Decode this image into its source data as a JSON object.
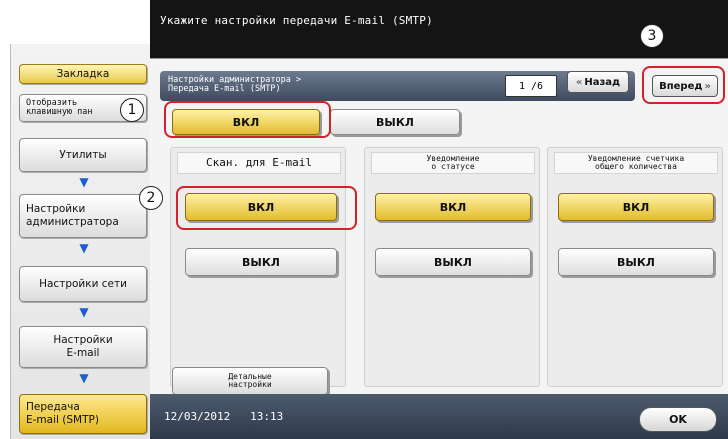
{
  "header": {
    "title": "Укажите настройки передачи  E-mail (SMTP)"
  },
  "sidebar": {
    "bookmark": "Закладка",
    "show_keypad_line1": "Отобразить",
    "show_keypad_line2": "клавишную пан",
    "items": [
      "Утилиты",
      "Настройки\nадминистратора",
      "Настройки сети",
      "Настройки\nE-mail",
      "Передача\nE-mail (SMTP)"
    ]
  },
  "breadcrumb": {
    "line1": "Настройки администратора >",
    "line2": "Передача E-mail (SMTP)"
  },
  "pager": {
    "page": "1 /6",
    "back": "Назад",
    "forward": "Вперед"
  },
  "main_toggle": {
    "on": "ВКЛ",
    "off": "ВЫКЛ",
    "selected": "on"
  },
  "columns": [
    {
      "header": "Скан. для E-mail",
      "on": "ВКЛ",
      "off": "ВЫКЛ",
      "selected": "on"
    },
    {
      "header": "Уведомление\nо статусе",
      "on": "ВКЛ",
      "off": "ВЫКЛ",
      "selected": "on"
    },
    {
      "header": "Уведомление счетчика\nобщего количества",
      "on": "ВКЛ",
      "off": "ВЫКЛ",
      "selected": "on"
    }
  ],
  "detail_button": "Детальные\nнастройки",
  "statusbar": {
    "date": "12/03/2012",
    "time": "13:13",
    "ok": "OK"
  },
  "callouts": [
    "1",
    "2",
    "3"
  ],
  "colors": {
    "header_bg": "#141414",
    "selected_gold": "#e2bc2c",
    "callout_red": "#d2232a",
    "arrow_blue": "#1e5fcf"
  }
}
